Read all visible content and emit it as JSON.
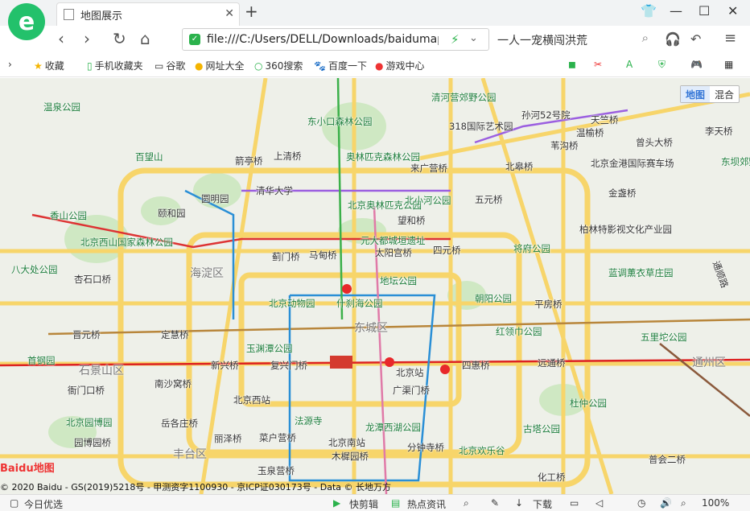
{
  "browser": {
    "tab_title": "地图展示",
    "url": "file:///C:/Users/DELL/Downloads/baidumap",
    "search_text": "一人一宠横闯洪荒"
  },
  "bookmarks": [
    "收藏",
    "手机收藏夹",
    "谷歌",
    "网址大全",
    "360搜索",
    "百度一下",
    "游戏中心"
  ],
  "map": {
    "toggle": {
      "map": "地图",
      "hybrid": "混合"
    },
    "logo_text": "Baidu地图",
    "copyright": "© 2020 Baidu - GS(2019)5218号 - 甲测资字1100930 - 京ICP证030173号 - Data © 长地万方",
    "districts": [
      "海淀区",
      "东城区",
      "石景山区",
      "丰台区",
      "通州区"
    ],
    "pois": [
      "温泉公园",
      "东小口森林公园",
      "清河营郊野公园",
      "孙河52号院",
      "318国际艺术园",
      "百望山",
      "奥林匹克森林公园",
      "北京金港国际赛车场",
      "东坝郊野",
      "清华大学",
      "圆明园",
      "颐和园",
      "北京奥林匹克公园",
      "北小河公园",
      "香山公园",
      "北京西山国家森林公园",
      "柏林特影视文化产业园",
      "元大都城垣遗址",
      "将府公园",
      "八大处公园",
      "地坛公园",
      "蓝调薰衣草庄园",
      "北京动物园",
      "什刹海公园",
      "朝阳公园",
      "红领巾公园",
      "五里坨公园",
      "首钢园",
      "玉渊潭公园",
      "北京站",
      "北京西站",
      "杜仲公园",
      "法源寺",
      "龙潭西湖公园",
      "古塔公园",
      "北京园博园",
      "北京欢乐谷",
      "北京南站"
    ],
    "bridges": [
      "上清桥",
      "箭亭桥",
      "来广营桥",
      "北皋桥",
      "五元桥",
      "望和桥",
      "四元桥",
      "太阳宫桥",
      "蓟门桥",
      "马甸桥",
      "杏石口桥",
      "晋元桥",
      "定慧桥",
      "新兴桥",
      "复兴门桥",
      "广渠门桥",
      "四惠桥",
      "远通桥",
      "平房桥",
      "南沙窝桥",
      "衙门口桥",
      "岳各庄桥",
      "丽泽桥",
      "菜户营桥",
      "木樨园桥",
      "玉泉营桥",
      "分钟寺桥",
      "化工桥",
      "普会二桥",
      "园博园桥",
      "金盏桥",
      "苇沟桥",
      "温榆桥",
      "天竺桥",
      "李天桥",
      "曾头大桥",
      "通顺路"
    ]
  },
  "status": [
    "今日优选",
    "快剪辑",
    "热点资讯",
    "下载",
    "100%"
  ]
}
